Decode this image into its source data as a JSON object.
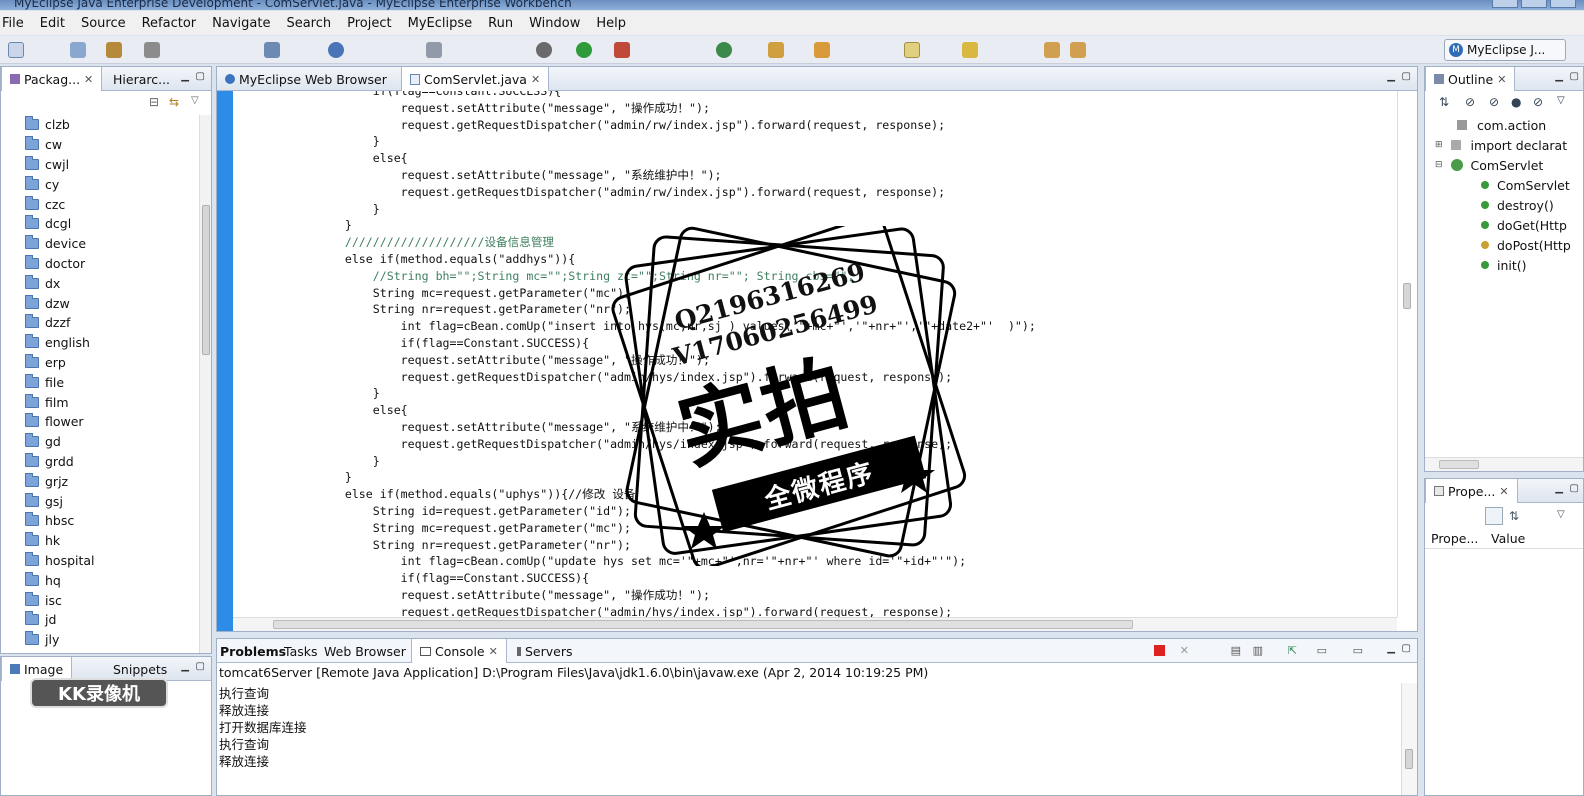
{
  "window": {
    "title": "MyEclipse Java Enterprise Development - ComServlet.java - MyEclipse Enterprise Workbench"
  },
  "menu": [
    "File",
    "Edit",
    "Source",
    "Refactor",
    "Navigate",
    "Search",
    "Project",
    "MyEclipse",
    "Run",
    "Window",
    "Help"
  ],
  "perspective": {
    "label": "MyEclipse J..."
  },
  "left_view": {
    "tabs": [
      "Packag...",
      "Hierarc..."
    ],
    "folders": [
      "clzb",
      "cw",
      "cwjl",
      "cy",
      "czc",
      "dcgl",
      "device",
      "doctor",
      "dx",
      "dzw",
      "dzzf",
      "english",
      "erp",
      "file",
      "film",
      "flower",
      "gd",
      "grdd",
      "grjz",
      "gsj",
      "hbsc",
      "hk",
      "hospital",
      "hq",
      "isc",
      "jd",
      "jly"
    ]
  },
  "left_bottom": {
    "tabs": [
      "Image",
      "Snippets"
    ]
  },
  "editor": {
    "tabs": [
      "MyEclipse Web Browser",
      "ComServlet.java"
    ],
    "lines": [
      "            if(flag==Constant.SUCCESS){",
      "                request.setAttribute(\"message\", \"操作成功！\");",
      "                request.getRequestDispatcher(\"admin/rw/index.jsp\").forward(request, response);",
      "            }",
      "            else{",
      "                request.setAttribute(\"message\", \"系统维护中！\");",
      "                request.getRequestDispatcher(\"admin/rw/index.jsp\").forward(request, response);",
      "            }",
      "        }",
      "        ////////////////////设备信息管理",
      "        else if(method.equals(\"addhys\")){",
      "            //String bh=\"\";String mc=\"\";String zt=\"\";String nr=\"\"; String cbs=\"\";",
      "            String mc=request.getParameter(\"mc\");",
      "            String nr=request.getParameter(\"nr\");",
      "                int flag=cBean.comUp(\"insert into hys(mc,nr,sj ) values('\"+mc+\"','\"+nr+\"','\"+date2+\"'  )\");",
      "                if(flag==Constant.SUCCESS){",
      "                request.setAttribute(\"message\", \"操作成功！\");",
      "                request.getRequestDispatcher(\"admin/hys/index.jsp\").forward(request, response);",
      "            }",
      "            else{",
      "                request.setAttribute(\"message\", \"系统维护中！\");",
      "                request.getRequestDispatcher(\"admin/hys/index.jsp\").forward(request, response);",
      "            }",
      "        }",
      "        else if(method.equals(\"uphys\")){//修改 设备",
      "            String id=request.getParameter(\"id\");",
      "            String mc=request.getParameter(\"mc\");",
      "            String nr=request.getParameter(\"nr\");",
      "                int flag=cBean.comUp(\"update hys set mc='\"+mc+\"',nr='\"+nr+\"' where id='\"+id+\"'\");",
      "                if(flag==Constant.SUCCESS){",
      "                request.setAttribute(\"message\", \"操作成功！\");",
      "                request.getRequestDispatcher(\"admin/hys/index.jsp\").forward(request, response);"
    ]
  },
  "outline": {
    "tab": "Outline",
    "items": [
      "com.action",
      "import declarat",
      "ComServlet",
      "ComServlet",
      "destroy()",
      "doGet(Http",
      "doPost(Http",
      "init()"
    ]
  },
  "properties": {
    "tab": "Prope...",
    "columns": [
      "Prope...",
      "Value"
    ]
  },
  "bottom": {
    "tabs": [
      "Problems",
      "Tasks",
      "Web Browser",
      "Console",
      "Servers"
    ],
    "header": "tomcat6Server [Remote Java Application] D:\\Program Files\\Java\\jdk1.6.0\\bin\\javaw.exe (Apr 2, 2014 10:19:25 PM)",
    "lines": [
      "执行查询",
      "释放连接",
      "打开数据库连接",
      "执行查询",
      "释放连接"
    ]
  },
  "watermark": {
    "line1": "Q2196316269",
    "line2": "V17060256499",
    "big": "实拍",
    "band": "全微程序"
  },
  "logo": {
    "text": "KK录像机"
  }
}
